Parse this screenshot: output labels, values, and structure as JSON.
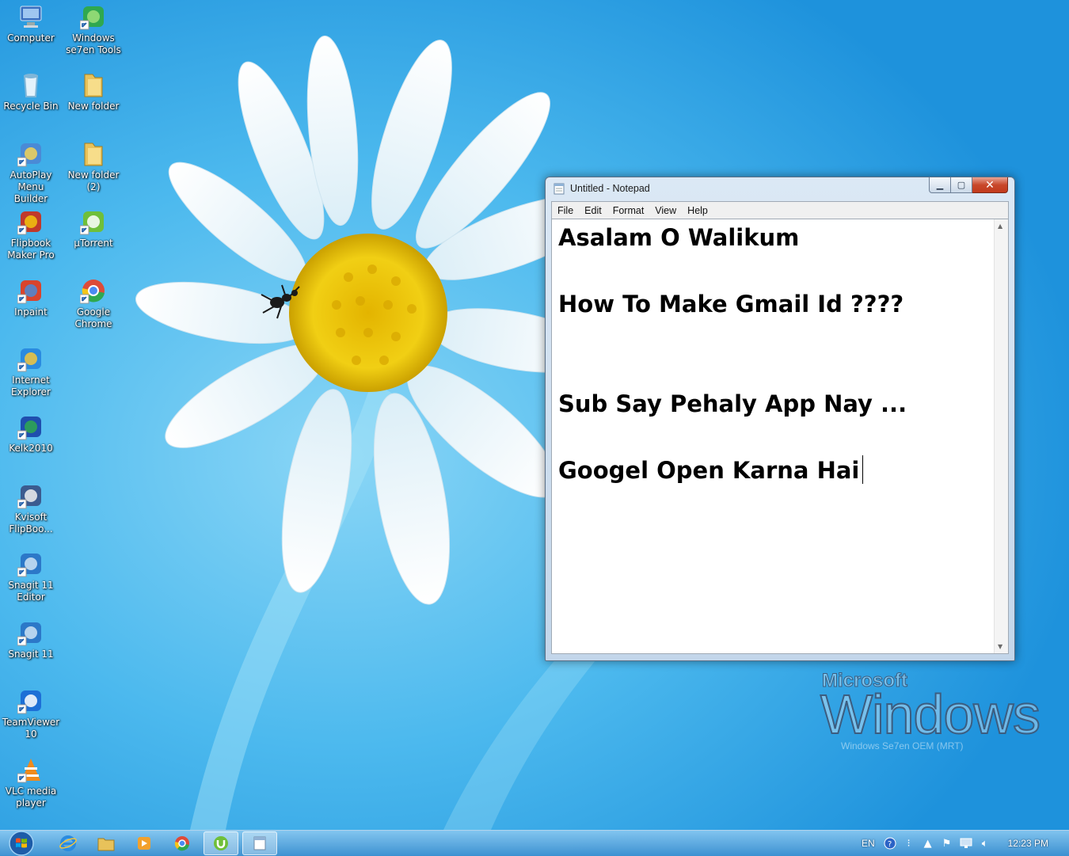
{
  "desktop": {
    "icons": [
      {
        "label": "Computer",
        "icon": "computer-icon"
      },
      {
        "label": "Windows\nse7en Tools",
        "icon": "windows-tools-icon"
      },
      {
        "label": "Recycle Bin",
        "icon": "recycle-bin-icon"
      },
      {
        "label": "New folder",
        "icon": "folder-icon"
      },
      {
        "label": "AutoPlay\nMenu Builder",
        "icon": "autoplay-icon"
      },
      {
        "label": "New folder\n(2)",
        "icon": "folder-icon"
      },
      {
        "label": "Flipbook\nMaker Pro",
        "icon": "flipbook-icon"
      },
      {
        "label": "µTorrent",
        "icon": "utorrent-icon"
      },
      {
        "label": "Inpaint",
        "icon": "inpaint-icon"
      },
      {
        "label": "Google\nChrome",
        "icon": "chrome-icon"
      },
      {
        "label": "Internet\nExplorer",
        "icon": "internet-explorer-icon"
      },
      {
        "label": "Kelk2010",
        "icon": "kelk-icon"
      },
      {
        "label": "Kvisoft\nFlipBoo...",
        "icon": "kvisoft-icon"
      },
      {
        "label": "Snagit 11\nEditor",
        "icon": "snagit-editor-icon"
      },
      {
        "label": "Snagit 11",
        "icon": "snagit-icon"
      },
      {
        "label": "TeamViewer\n10",
        "icon": "teamviewer-icon"
      },
      {
        "label": "VLC media\nplayer",
        "icon": "vlc-icon"
      }
    ]
  },
  "notepad": {
    "title": "Untitled - Notepad",
    "menu": [
      "File",
      "Edit",
      "Format",
      "View",
      "Help"
    ],
    "lines": [
      "Asalam O Walikum",
      "",
      "How To Make Gmail Id ????",
      "",
      "",
      "Sub Say Pehaly App Nay ...",
      "",
      "Googel Open Karna Hai"
    ]
  },
  "watermark": {
    "brand": "Microsoft",
    "product": "Windows",
    "edition": "Windows Se7en OEM (MRT)"
  },
  "taskbar": {
    "language": "EN",
    "clock": "12:23 PM",
    "pinned": [
      "internet-explorer-icon",
      "explorer-folder-icon",
      "media-player-icon",
      "chrome-icon",
      "utorrent-icon",
      "notepad-icon"
    ]
  },
  "colors": {
    "accent": "#3aa7e6",
    "close_button": "#c8482b"
  }
}
